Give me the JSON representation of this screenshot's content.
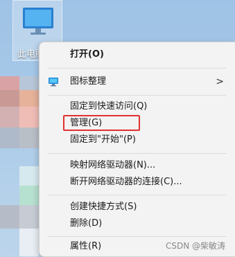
{
  "desktop_icon": {
    "label": "此电脑"
  },
  "menu": {
    "items": [
      {
        "label": "打开(O)"
      },
      {
        "label": "图标整理"
      },
      {
        "label": "固定到快速访问(Q)"
      },
      {
        "label": "管理(G)"
      },
      {
        "label": "固定到\"开始\"(P)"
      },
      {
        "label": "映射网络驱动器(N)..."
      },
      {
        "label": "断开网络驱动器的连接(C)..."
      },
      {
        "label": "创建快捷方式(S)"
      },
      {
        "label": "删除(D)"
      },
      {
        "label": "属性(R)"
      }
    ],
    "submenu_arrow": ">"
  },
  "watermark": "CSDN @柴敏涛",
  "colors": {
    "highlight_border": "#e03030",
    "menu_bg": "#f3f3f3"
  }
}
